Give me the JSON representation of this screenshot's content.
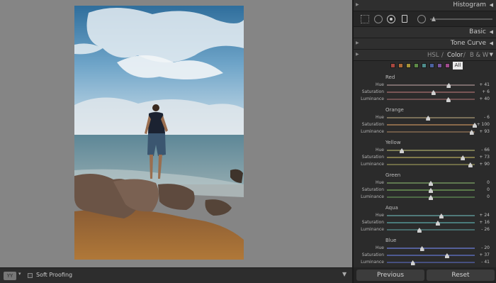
{
  "panel": {
    "histogram_title": "Histogram",
    "basic_title": "Basic",
    "tone_curve_title": "Tone Curve",
    "hsl_tabs": [
      "HSL",
      "/",
      "Color",
      "/",
      "B & W"
    ],
    "all_label": "All",
    "swatch_colors": [
      "#a8473f",
      "#b06a36",
      "#a69338",
      "#5d8a47",
      "#4e8c8b",
      "#4b62a0",
      "#7a55a0",
      "#a04a8c"
    ],
    "groups": [
      {
        "name": "Red",
        "rows": [
          {
            "label": "Hue",
            "value": "+ 41",
            "level": 0.705,
            "track": "#7a6b6b"
          },
          {
            "label": "Saturation",
            "value": "+ 6",
            "level": 0.53,
            "track": "#7a5656"
          },
          {
            "label": "Luminance",
            "value": "+ 40",
            "level": 0.7,
            "track": "#6e5050"
          }
        ]
      },
      {
        "name": "Orange",
        "rows": [
          {
            "label": "Hue",
            "value": "- 6",
            "level": 0.47,
            "track": "#7a6f58"
          },
          {
            "label": "Saturation",
            "value": "+ 100",
            "level": 1.0,
            "track": "#8a6a4a"
          },
          {
            "label": "Luminance",
            "value": "+ 93",
            "level": 0.965,
            "track": "#6e5a46"
          }
        ]
      },
      {
        "name": "Yellow",
        "rows": [
          {
            "label": "Hue",
            "value": "- 66",
            "level": 0.17,
            "track": "#7a7a52"
          },
          {
            "label": "Saturation",
            "value": "+ 73",
            "level": 0.865,
            "track": "#807a4a"
          },
          {
            "label": "Luminance",
            "value": "+ 90",
            "level": 0.95,
            "track": "#6e6c46"
          }
        ]
      },
      {
        "name": "Green",
        "rows": [
          {
            "label": "Hue",
            "value": "0",
            "level": 0.5,
            "track": "#607850"
          },
          {
            "label": "Saturation",
            "value": "0",
            "level": 0.5,
            "track": "#5a7a4a"
          },
          {
            "label": "Luminance",
            "value": "0",
            "level": 0.5,
            "track": "#4e6a46"
          }
        ]
      },
      {
        "name": "Aqua",
        "rows": [
          {
            "label": "Hue",
            "value": "+ 24",
            "level": 0.62,
            "track": "#507a7a"
          },
          {
            "label": "Saturation",
            "value": "+ 16",
            "level": 0.58,
            "track": "#4a7a7a"
          },
          {
            "label": "Luminance",
            "value": "- 26",
            "level": 0.37,
            "track": "#466a6a"
          }
        ]
      },
      {
        "name": "Blue",
        "rows": [
          {
            "label": "Hue",
            "value": "- 20",
            "level": 0.4,
            "track": "#55609a"
          },
          {
            "label": "Saturation",
            "value": "+ 37",
            "level": 0.685,
            "track": "#4e5a92"
          },
          {
            "label": "Luminance",
            "value": "- 41",
            "level": 0.295,
            "track": "#465080"
          }
        ]
      }
    ],
    "previous_label": "Previous",
    "reset_label": "Reset"
  },
  "toolbar": {
    "view_mode": "YY",
    "soft_proofing_label": "Soft Proofing"
  },
  "icons": {
    "collapse_left": "◀",
    "collapse_down": "▼",
    "edge": "◀",
    "edge_right": "▶",
    "chevron": "▾",
    "menu": "▼"
  }
}
